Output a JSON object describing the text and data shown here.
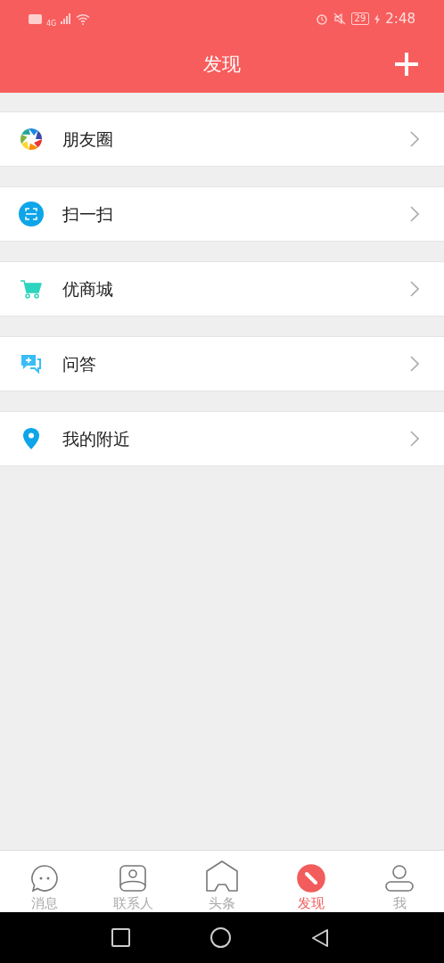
{
  "status_bar": {
    "network": "4G",
    "battery": "29",
    "time": "2:48"
  },
  "header": {
    "title": "发现"
  },
  "items": [
    {
      "kind": "moments",
      "label": "朋友圈"
    },
    {
      "kind": "scan",
      "label": "扫一扫"
    },
    {
      "kind": "shop",
      "label": "优商城"
    },
    {
      "kind": "qa",
      "label": "问答"
    },
    {
      "kind": "nearby",
      "label": "我的附近"
    }
  ],
  "tabs": [
    {
      "kind": "chat",
      "label": "消息",
      "selected": false
    },
    {
      "kind": "contacts",
      "label": "联系人",
      "selected": false
    },
    {
      "kind": "home",
      "label": "头条",
      "selected": false
    },
    {
      "kind": "discover",
      "label": "发现",
      "selected": true
    },
    {
      "kind": "me",
      "label": "我",
      "selected": false
    }
  ]
}
